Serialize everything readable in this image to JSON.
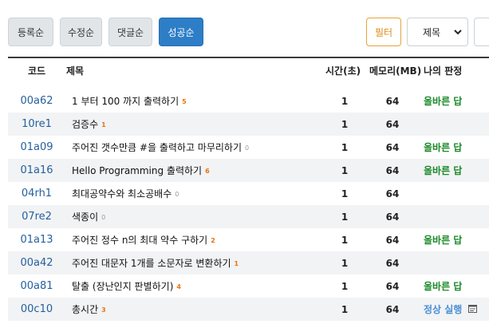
{
  "sort_buttons": [
    {
      "label": "등록순",
      "active": false
    },
    {
      "label": "수정순",
      "active": false
    },
    {
      "label": "댓글순",
      "active": false
    },
    {
      "label": "성공순",
      "active": true
    }
  ],
  "filter": {
    "label": "필터"
  },
  "field_select": {
    "value": "제목"
  },
  "table": {
    "headers": {
      "code": "코드",
      "title": "제목",
      "time": "시간(초)",
      "memory": "메모리(MB)",
      "result": "나의 판정"
    },
    "rows": [
      {
        "code": "00a62",
        "title": "1 부터 100 까지 출력하기",
        "count": "5",
        "time": "1",
        "memory": "64",
        "result": "올바른 답"
      },
      {
        "code": "10re1",
        "title": "검증수",
        "count": "1",
        "time": "1",
        "memory": "64",
        "result": ""
      },
      {
        "code": "01a09",
        "title": "주어진 갯수만큼 #을 출력하고 마무리하기",
        "count": "0",
        "time": "1",
        "memory": "64",
        "result": "올바른 답"
      },
      {
        "code": "01a16",
        "title": "Hello Programming 출력하기",
        "count": "6",
        "time": "1",
        "memory": "64",
        "result": "올바른 답"
      },
      {
        "code": "04rh1",
        "title": "최대공약수와 최소공배수",
        "count": "0",
        "time": "1",
        "memory": "64",
        "result": ""
      },
      {
        "code": "07re2",
        "title": "색종이",
        "count": "0",
        "time": "1",
        "memory": "64",
        "result": ""
      },
      {
        "code": "01a13",
        "title": "주어진 정수 n의 최대 약수 구하기",
        "count": "2",
        "time": "1",
        "memory": "64",
        "result": "올바른 답"
      },
      {
        "code": "00a42",
        "title": "주어진 대문자 1개를 소문자로 변환하기",
        "count": "1",
        "time": "1",
        "memory": "64",
        "result": ""
      },
      {
        "code": "00a81",
        "title": "탈출 (장난인지 판별하기)",
        "count": "4",
        "time": "1",
        "memory": "64",
        "result": "올바른 답"
      },
      {
        "code": "00c10",
        "title": "총시간",
        "count": "3",
        "time": "1",
        "memory": "64",
        "result": "정상 실행"
      }
    ]
  }
}
